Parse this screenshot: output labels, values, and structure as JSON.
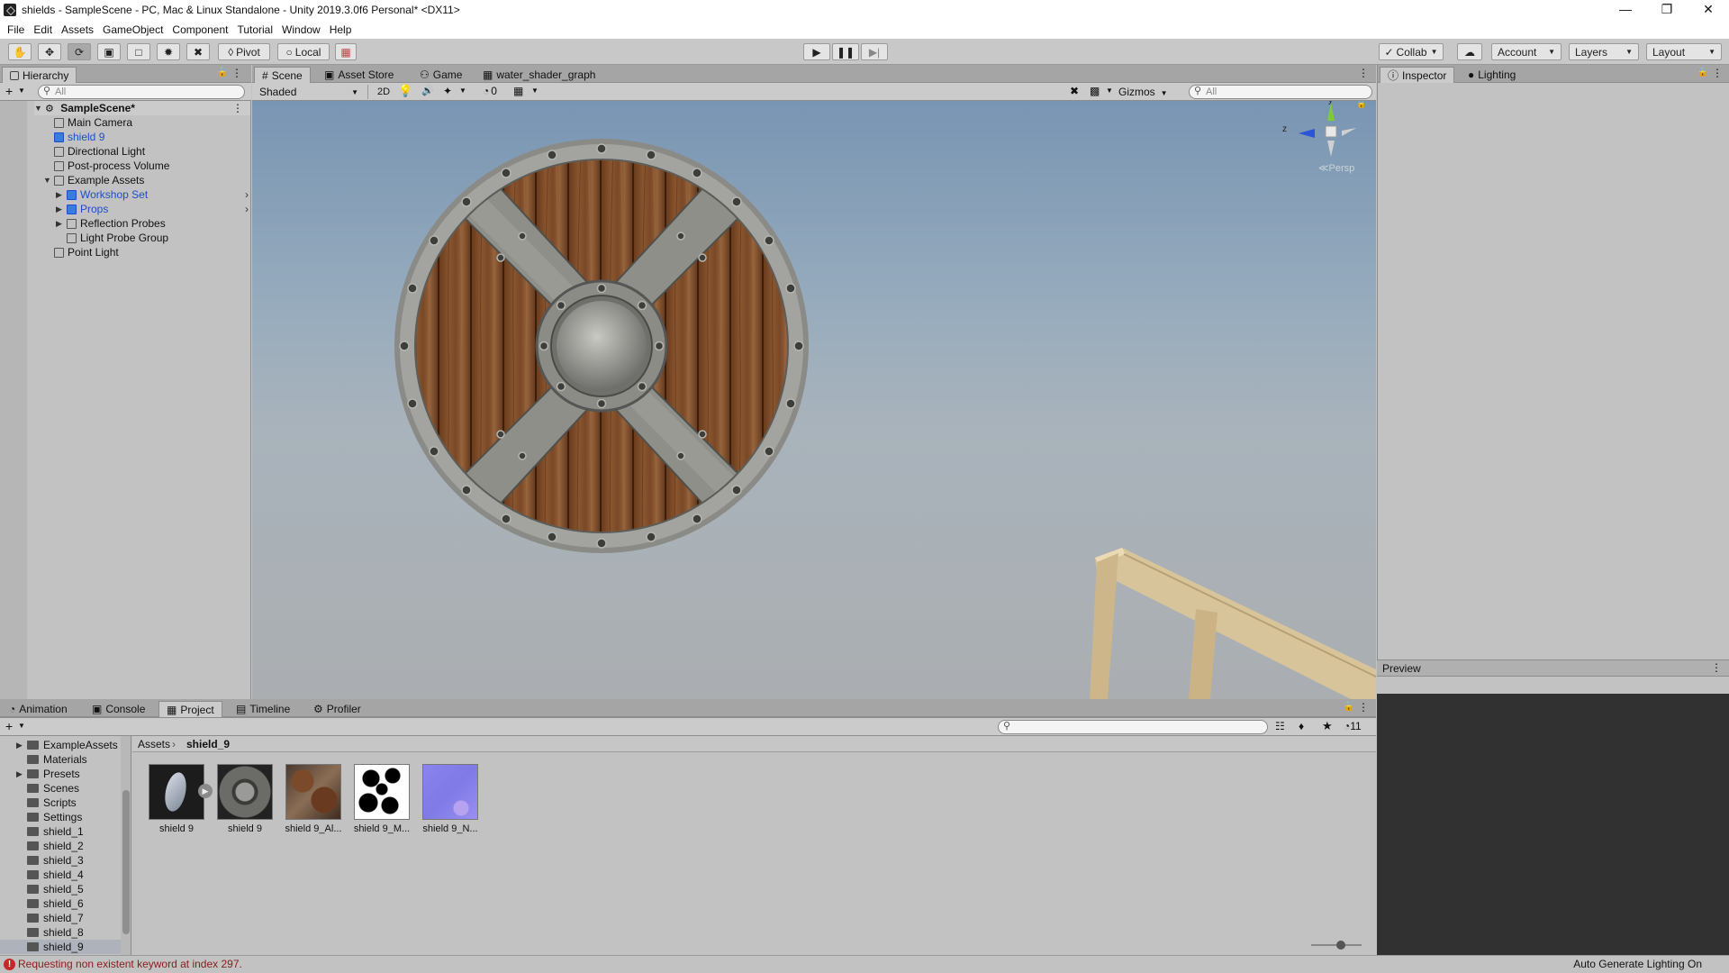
{
  "window": {
    "title": "shields - SampleScene - PC, Mac & Linux Standalone - Unity 2019.3.0f6 Personal* <DX11>"
  },
  "menu": [
    "File",
    "Edit",
    "Assets",
    "GameObject",
    "Component",
    "Tutorial",
    "Window",
    "Help"
  ],
  "toolbar": {
    "pivot": "Pivot",
    "local": "Local",
    "collab": "Collab",
    "account": "Account",
    "layers": "Layers",
    "layout": "Layout"
  },
  "hierarchy": {
    "tab": "Hierarchy",
    "search_placeholder": "All",
    "scene": "SampleScene*",
    "items": [
      {
        "label": "Main Camera",
        "kind": "object"
      },
      {
        "label": "shield 9",
        "kind": "selected"
      },
      {
        "label": "Directional Light",
        "kind": "object"
      },
      {
        "label": "Post-process Volume",
        "kind": "object"
      },
      {
        "label": "Example Assets",
        "kind": "object"
      },
      {
        "label": "Workshop Set",
        "kind": "prefab"
      },
      {
        "label": "Props",
        "kind": "prefab"
      },
      {
        "label": "Reflection Probes",
        "kind": "object"
      },
      {
        "label": "Light Probe Group",
        "kind": "object"
      },
      {
        "label": "Point Light",
        "kind": "object"
      }
    ]
  },
  "scene": {
    "tabs": [
      "Scene",
      "Asset Store",
      "Game",
      "water_shader_graph"
    ],
    "shading": "Shaded",
    "mode_2d": "2D",
    "hidden_count": "0",
    "gizmos": "Gizmos",
    "search_placeholder": "All",
    "persp": "Persp",
    "axes": {
      "y": "y",
      "z": "z"
    }
  },
  "inspector": {
    "tabs": [
      "Inspector",
      "Lighting"
    ],
    "preview": "Preview"
  },
  "bottom_tabs": [
    "Animation",
    "Console",
    "Project",
    "Timeline",
    "Profiler"
  ],
  "project": {
    "folders": [
      "ExampleAssets",
      "Materials",
      "Presets",
      "Scenes",
      "Scripts",
      "Settings",
      "shield_1",
      "shield_2",
      "shield_3",
      "shield_4",
      "shield_5",
      "shield_6",
      "shield_7",
      "shield_8",
      "shield_9"
    ],
    "breadcrumb": [
      "Assets",
      "shield_9"
    ],
    "hidden_count": "11",
    "assets": [
      {
        "label": "shield 9",
        "thumb": "model"
      },
      {
        "label": "shield 9",
        "thumb": "material"
      },
      {
        "label": "shield 9_Al...",
        "thumb": "albedo"
      },
      {
        "label": "shield 9_M...",
        "thumb": "mask"
      },
      {
        "label": "shield 9_N...",
        "thumb": "normal"
      }
    ]
  },
  "status": {
    "message": "Requesting non existent keyword at index 297.",
    "right": "Auto Generate Lighting On"
  }
}
